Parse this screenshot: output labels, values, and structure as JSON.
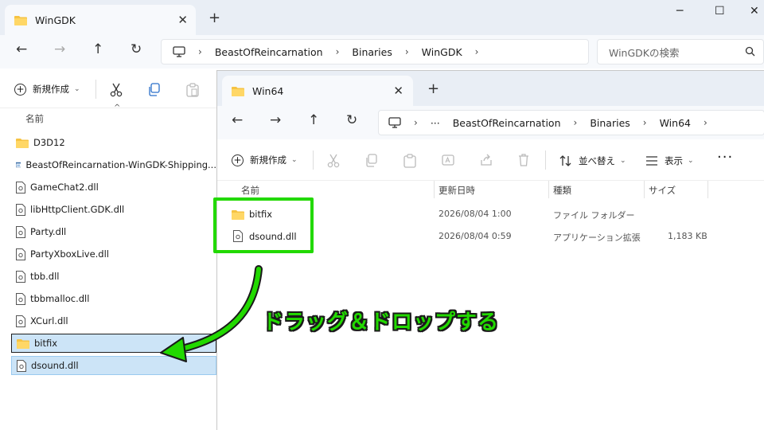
{
  "back_window": {
    "tab_title": "WinGDK",
    "tab_close": "✕",
    "new_tab": "+",
    "window_controls": {
      "minimize": "─",
      "maximize": "☐",
      "close": "✕"
    },
    "breadcrumb": [
      "BeastOfReincarnation",
      "Binaries",
      "WinGDK"
    ],
    "search_placeholder": "WinGDKの検索",
    "new_button_label": "新規作成",
    "column_name": "名前",
    "files": [
      {
        "name": "D3D12",
        "icon": "folder-icon"
      },
      {
        "name": "BeastOfReincarnation-WinGDK-Shipping...",
        "icon": "exe-icon"
      },
      {
        "name": "GameChat2.dll",
        "icon": "dll-icon"
      },
      {
        "name": "libHttpClient.GDK.dll",
        "icon": "dll-icon"
      },
      {
        "name": "Party.dll",
        "icon": "dll-icon"
      },
      {
        "name": "PartyXboxLive.dll",
        "icon": "dll-icon"
      },
      {
        "name": "tbb.dll",
        "icon": "dll-icon"
      },
      {
        "name": "tbbmalloc.dll",
        "icon": "dll-icon"
      },
      {
        "name": "XCurl.dll",
        "icon": "dll-icon"
      },
      {
        "name": "bitfix",
        "icon": "folder-icon"
      },
      {
        "name": "dsound.dll",
        "icon": "dll-icon"
      }
    ]
  },
  "front_window": {
    "tab_title": "Win64",
    "tab_close": "✕",
    "new_tab": "+",
    "breadcrumb_ellipsis": "···",
    "breadcrumb": [
      "BeastOfReincarnation",
      "Binaries",
      "Win64"
    ],
    "new_button_label": "新規作成",
    "sort_label": "並べ替え",
    "view_label": "表示",
    "more_label": "···",
    "columns": {
      "name": "名前",
      "modified": "更新日時",
      "type": "種類",
      "size": "サイズ"
    },
    "rows": [
      {
        "name": "bitfix",
        "modified": "2026/08/04 1:00",
        "type": "ファイル フォルダー",
        "size": "",
        "icon": "folder-icon"
      },
      {
        "name": "dsound.dll",
        "modified": "2026/08/04 0:59",
        "type": "アプリケーション拡張",
        "size": "1,183 KB",
        "icon": "dll-icon"
      }
    ]
  },
  "annotation": {
    "label": "ドラッグ＆ドロップする",
    "color": "#22d900"
  },
  "colors": {
    "accent_green": "#22d900",
    "folder_yellow": "#f6c343",
    "selection_blue": "#cce4f7"
  }
}
